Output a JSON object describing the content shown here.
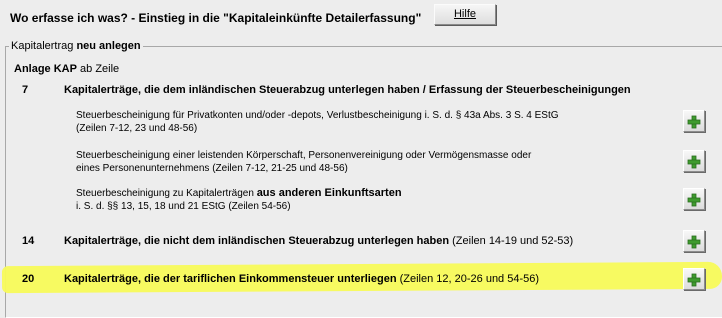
{
  "header": {
    "title": "Wo erfasse ich was? - Einstieg in die \"Kapitaleinkünfte Detailerfassung\"",
    "help_label": "Hilfe"
  },
  "group": {
    "legend_prefix": "Kapitalertrag ",
    "legend_bold": "neu anlegen"
  },
  "anlage": {
    "bold": "Anlage KAP",
    "rest": " ab Zeile"
  },
  "rows": [
    {
      "number": "7",
      "title": "Kapitalerträge, die dem inländischen Steuerabzug unterlegen haben / Erfassung der Steuerbescheinigungen",
      "subitems": [
        {
          "line1": "Steuerbescheinigung für Privatkonten und/oder -depots, Verlustbescheinigung i. S. d. § 43a Abs. 3 S. 4 EStG",
          "line2": "(Zeilen 7-12, 23 und 48-56)"
        },
        {
          "line1": "Steuerbescheinigung einer leistenden Körperschaft, Personenvereinigung oder Vermögensmasse oder",
          "line2": "eines Personenunternehmens (Zeilen 7-12, 21-25 und 48-56)"
        },
        {
          "line1_prefix": "Steuerbescheinigung zu Kapitalerträgen ",
          "line1_bold": "aus anderen Einkunftsarten",
          "line2": "i. S. d. §§ 13, 15, 18 und 21 EStG (Zeilen 54-56)"
        }
      ]
    },
    {
      "number": "14",
      "title": "Kapitalerträge, die nicht dem inländischen Steuerabzug unterlegen haben",
      "suffix": " (Zeilen 14-19 und 52-53)"
    },
    {
      "number": "20",
      "title": "Kapitalerträge, die der tariflichen Einkommensteuer unterliegen",
      "suffix": " (Zeilen 12, 20-26 und 54-56)"
    }
  ],
  "colors": {
    "background": "#ededed",
    "highlight": "#f8fb5a",
    "plus_green": "#3f9b2e"
  },
  "icons": {
    "add": "plus-icon"
  }
}
